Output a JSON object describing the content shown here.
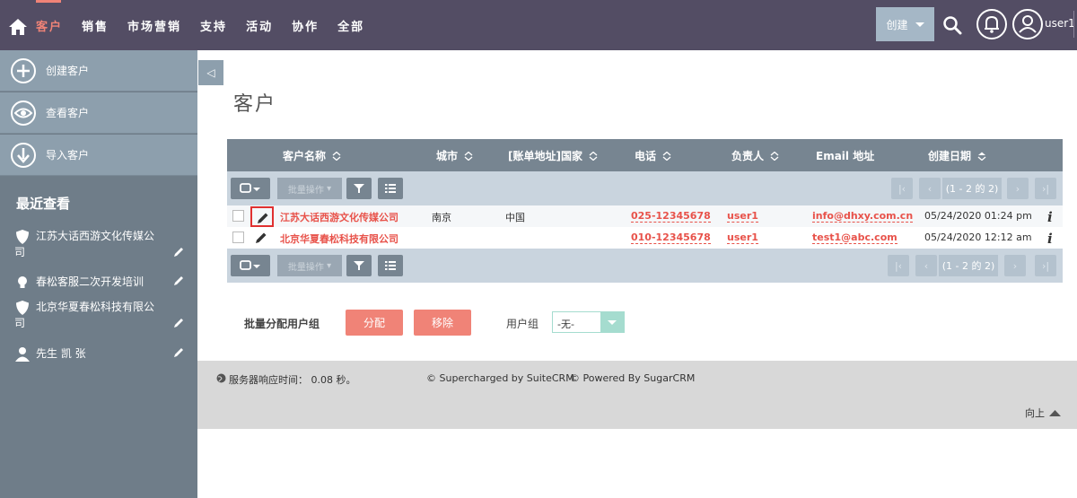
{
  "nav": {
    "items": [
      "客户",
      "销售",
      "市场营销",
      "支持",
      "活动",
      "协作",
      "全部"
    ],
    "create_label": "创建",
    "username": "user1"
  },
  "sidebar": {
    "actions": [
      {
        "label": "创建客户",
        "icon": "plus-circle-icon"
      },
      {
        "label": "查看客户",
        "icon": "eye-icon"
      },
      {
        "label": "导入客户",
        "icon": "download-icon"
      }
    ],
    "recent_title": "最近查看",
    "recent": [
      {
        "line1": "江苏大话西游文化传媒公",
        "line2": "司",
        "icon": "shield-icon"
      },
      {
        "line1": "春松客服二次开发培训",
        "line2": "",
        "icon": "lightbulb-icon"
      },
      {
        "line1": "北京华夏春松科技有限公",
        "line2": "司",
        "icon": "shield-icon"
      },
      {
        "line1": "先生 凯 张",
        "line2": "",
        "icon": "person-icon"
      }
    ]
  },
  "collapse_label": "◁",
  "page_title": "客户",
  "table": {
    "columns": [
      "客户名称",
      "城市",
      "[账单地址]国家",
      "电话",
      "负责人",
      "Email 地址",
      "创建日期"
    ],
    "bulk_label": "批量操作",
    "pagination": "(1 - 2 的 2)",
    "rows": [
      {
        "name": "江苏大话西游文化传媒公司",
        "city": "南京",
        "country": "中国",
        "phone": "025-12345678",
        "owner": "user1",
        "email": "info@dhxy.com.cn",
        "date": "05/24/2020 01:24 pm",
        "info": "i"
      },
      {
        "name": "北京华夏春松科技有限公司",
        "city": "",
        "country": "",
        "phone": "010-12345678",
        "owner": "user1",
        "email": "test1@abc.com",
        "date": "05/24/2020 12:12 am",
        "info": "i"
      }
    ]
  },
  "bulk_assign": {
    "label": "批量分配用户组",
    "assign_label": "分配",
    "remove_label": "移除",
    "group_label": "用户组",
    "group_value": "-无-"
  },
  "footer": {
    "server_time": "服务器响应时间： 0.08 秒。",
    "supercharged": "© Supercharged by SuiteCRM",
    "powered": "© Powered By SugarCRM",
    "back_to_top": "向上"
  },
  "colors": {
    "nav_bg": "#534d64",
    "accent": "#f08377",
    "sidebar_bg": "#6f7d89",
    "table_header": "#778591"
  }
}
